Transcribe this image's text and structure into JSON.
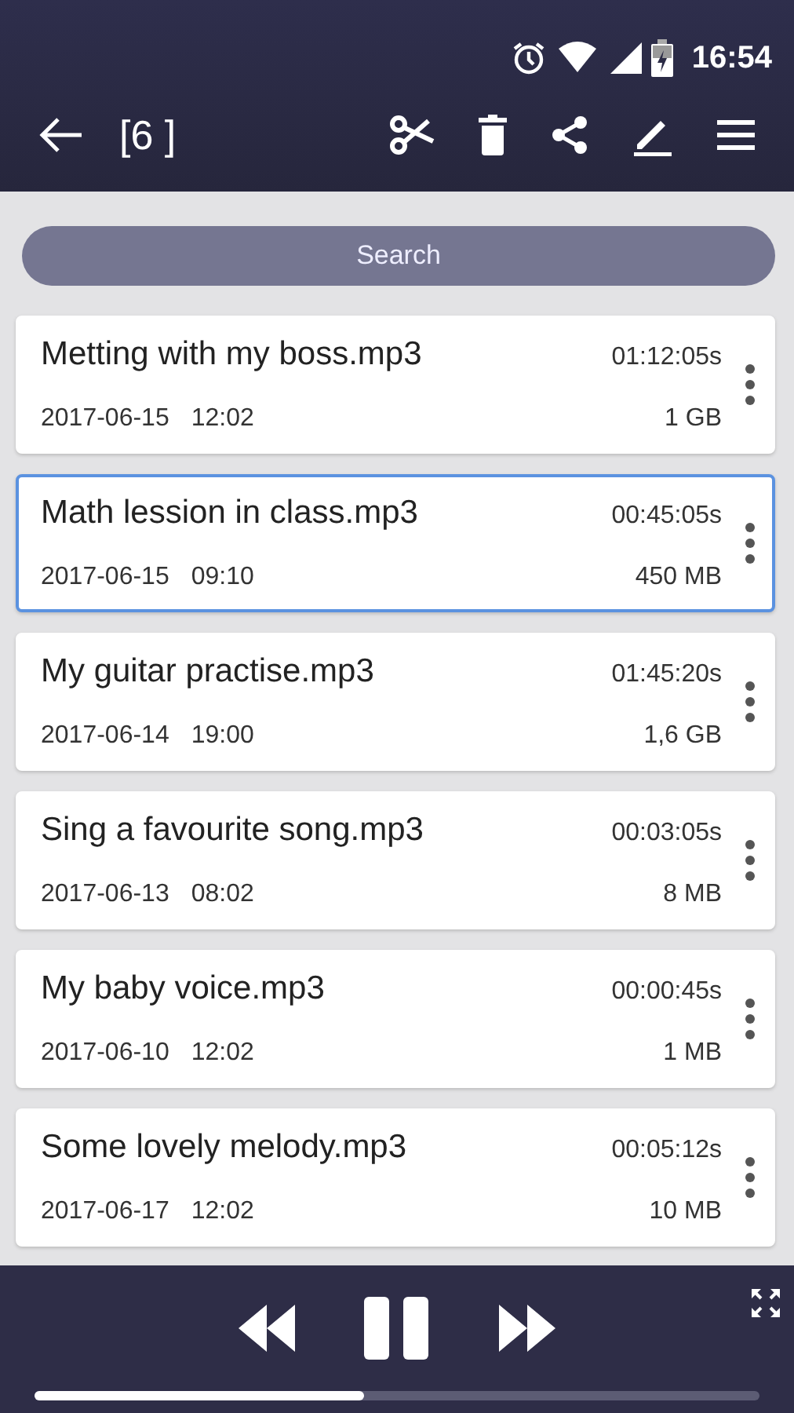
{
  "status_bar": {
    "time": "16:54"
  },
  "toolbar": {
    "title": "[6 ]"
  },
  "search": {
    "placeholder": "Search"
  },
  "recordings": [
    {
      "name": "Metting with my boss.mp3",
      "duration": "01:12:05s",
      "date": "2017-06-15",
      "time": "12:02",
      "size": "1 GB",
      "selected": false
    },
    {
      "name": "Math lession in class.mp3",
      "duration": "00:45:05s",
      "date": "2017-06-15",
      "time": "09:10",
      "size": "450 MB",
      "selected": true
    },
    {
      "name": "My guitar practise.mp3",
      "duration": "01:45:20s",
      "date": "2017-06-14",
      "time": "19:00",
      "size": "1,6 GB",
      "selected": false
    },
    {
      "name": "Sing a favourite song.mp3",
      "duration": "00:03:05s",
      "date": "2017-06-13",
      "time": "08:02",
      "size": "8 MB",
      "selected": false
    },
    {
      "name": "My baby voice.mp3",
      "duration": "00:00:45s",
      "date": "2017-06-10",
      "time": "12:02",
      "size": "1 MB",
      "selected": false
    },
    {
      "name": "Some lovely melody.mp3",
      "duration": "00:05:12s",
      "date": "2017-06-17",
      "time": "12:02",
      "size": "10 MB",
      "selected": false
    }
  ],
  "player": {
    "level": 0.455
  }
}
